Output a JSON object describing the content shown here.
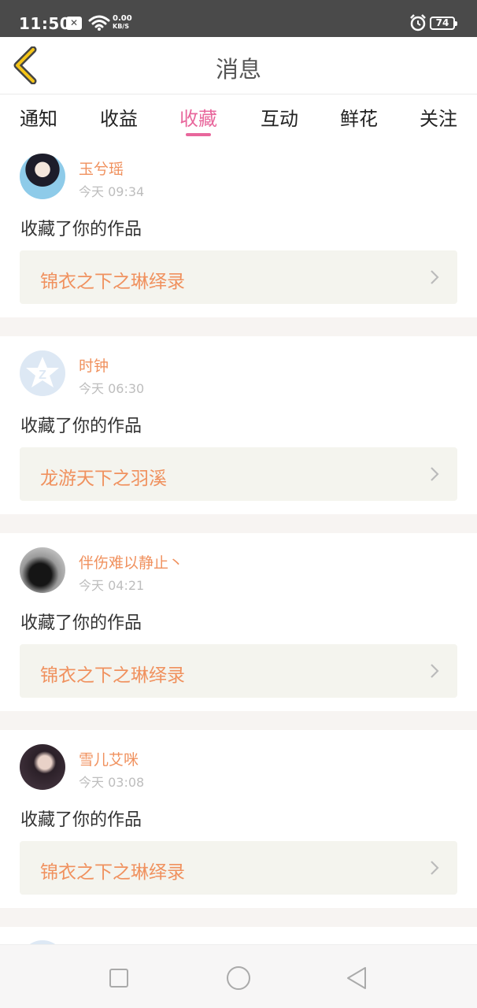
{
  "status_bar": {
    "time": "11:50",
    "net_speed_value": "0.00",
    "net_speed_unit": "KB/S",
    "battery": "74"
  },
  "header": {
    "title": "消息",
    "back_icon": "chevron-left-icon"
  },
  "tabs": [
    {
      "label": "通知",
      "active": false
    },
    {
      "label": "收益",
      "active": false
    },
    {
      "label": "收藏",
      "active": true
    },
    {
      "label": "互动",
      "active": false
    },
    {
      "label": "鲜花",
      "active": false
    },
    {
      "label": "关注",
      "active": false
    }
  ],
  "notifications": [
    {
      "user": "玉兮瑶",
      "time": "今天 09:34",
      "action": "收藏了你的作品",
      "work": "锦衣之下之琳绎录"
    },
    {
      "user": "时钟",
      "time": "今天 06:30",
      "action": "收藏了你的作品",
      "work": "龙游天下之羽溪"
    },
    {
      "user": "伴伤难以静止丶",
      "time": "今天 04:21",
      "action": "收藏了你的作品",
      "work": "锦衣之下之琳绎录"
    },
    {
      "user": "雪儿艾咪",
      "time": "今天 03:08",
      "action": "收藏了你的作品",
      "work": "锦衣之下之琳绎录"
    }
  ],
  "colors": {
    "accent_pink": "#e8679c",
    "name_orange": "#f0915e",
    "back_yellow": "#f5c518"
  }
}
